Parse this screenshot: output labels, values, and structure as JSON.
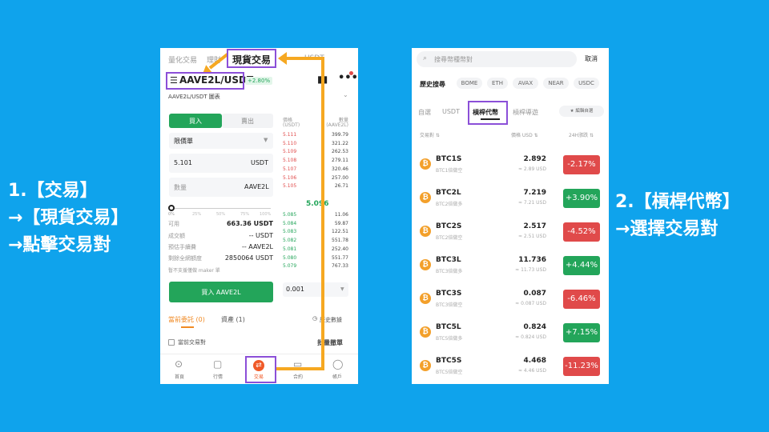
{
  "colors": {
    "background": "#0fa3ec",
    "buy": "#23a55a",
    "sell": "#e04a4a",
    "highlight": "#8b4fd8",
    "arrow": "#f6a821"
  },
  "caption_left": [
    "1.【交易】",
    "→【現貨交易】",
    "→點擊交易對"
  ],
  "caption_right": [
    "2.【槓桿代幣】",
    "→選擇交易對"
  ],
  "left": {
    "top_tabs": [
      "量化交易",
      "理財",
      "現貨交易",
      "USDT"
    ],
    "pair": "AAVE2L/USDT",
    "change": "+2.80%",
    "chart_link": "AAVE2L/USDT 圖表",
    "buy_tab": "買入",
    "sell_tab": "賣出",
    "order_type": "限價單",
    "price_value": "5.101",
    "price_unit": "USDT",
    "qty_placeholder": "數量",
    "qty_unit": "AAVE2L",
    "slider_marks": [
      "0%",
      "25%",
      "50%",
      "75%",
      "100%"
    ],
    "info": [
      {
        "label": "可用",
        "value": "663.36 USDT"
      },
      {
        "label": "成交額",
        "value": "-- USDT"
      },
      {
        "label": "預估手續費",
        "value": "-- AAVE2L"
      },
      {
        "label": "剩餘全網額度",
        "value": "2850064 USDT"
      }
    ],
    "note": "暫不支援僅做 maker 單",
    "buy_button": "買入 AAVE2L",
    "book_headers": {
      "price": "價格",
      "price_unit": "(USDT)",
      "qty": "數量",
      "qty_unit": "(AAVE2L)"
    },
    "asks": [
      {
        "price": "5.111",
        "qty": "399.79"
      },
      {
        "price": "5.110",
        "qty": "321.22"
      },
      {
        "price": "5.109",
        "qty": "262.53"
      },
      {
        "price": "5.108",
        "qty": "279.11"
      },
      {
        "price": "5.107",
        "qty": "320.46"
      },
      {
        "price": "5.106",
        "qty": "257.00"
      },
      {
        "price": "5.105",
        "qty": "26.71"
      }
    ],
    "mid_price": "5.096",
    "bids": [
      {
        "price": "5.085",
        "qty": "11.06"
      },
      {
        "price": "5.084",
        "qty": "59.87"
      },
      {
        "price": "5.083",
        "qty": "122.51"
      },
      {
        "price": "5.082",
        "qty": "551.78"
      },
      {
        "price": "5.081",
        "qty": "252.40"
      },
      {
        "price": "5.080",
        "qty": "551.77"
      },
      {
        "price": "5.079",
        "qty": "767.33"
      }
    ],
    "depth": "0.001",
    "orders_tab": "當前委託 (0)",
    "assets_tab": "資產 (1)",
    "history_link": "歷史數據",
    "current_pair_label": "當前交易對",
    "cancel_all": "批量撤單",
    "bottom_nav": [
      "首頁",
      "行情",
      "交易",
      "合約",
      "帳戶"
    ],
    "callout": "現貨交易"
  },
  "right": {
    "search_placeholder": "搜尋幣種幣對",
    "cancel": "取消",
    "history_label": "歷史搜尋",
    "history_chips": [
      "BOME",
      "ETH",
      "AVAX",
      "NEAR",
      "USDC"
    ],
    "tabs": [
      "自選",
      "USDT",
      "槓桿代幣",
      "槓桿導遊"
    ],
    "edit_label": "★ 編輯自選",
    "headers": {
      "pair": "交易對 ⇅",
      "price": "價格 USD ⇅",
      "change": "24H漲跌 ⇅"
    },
    "rows": [
      {
        "symbol": "BTC1S",
        "sub": "BTC1倍做空",
        "price": "2.892",
        "usd": "≈ 2.89 USD",
        "change": "-2.17%",
        "up": false
      },
      {
        "symbol": "BTC2L",
        "sub": "BTC2倍做多",
        "price": "7.219",
        "usd": "≈ 7.21 USD",
        "change": "+3.90%",
        "up": true
      },
      {
        "symbol": "BTC2S",
        "sub": "BTC2倍做空",
        "price": "2.517",
        "usd": "≈ 2.51 USD",
        "change": "-4.52%",
        "up": false
      },
      {
        "symbol": "BTC3L",
        "sub": "BTC3倍做多",
        "price": "11.736",
        "usd": "≈ 11.73 USD",
        "change": "+4.44%",
        "up": true
      },
      {
        "symbol": "BTC3S",
        "sub": "BTC3倍做空",
        "price": "0.087",
        "usd": "≈ 0.087 USD",
        "change": "-6.46%",
        "up": false
      },
      {
        "symbol": "BTC5L",
        "sub": "BTC5倍做多",
        "price": "0.824",
        "usd": "≈ 0.824 USD",
        "change": "+7.15%",
        "up": true
      },
      {
        "symbol": "BTC5S",
        "sub": "BTC5倍做空",
        "price": "4.468",
        "usd": "≈ 4.46 USD",
        "change": "-11.23%",
        "up": false
      }
    ]
  }
}
